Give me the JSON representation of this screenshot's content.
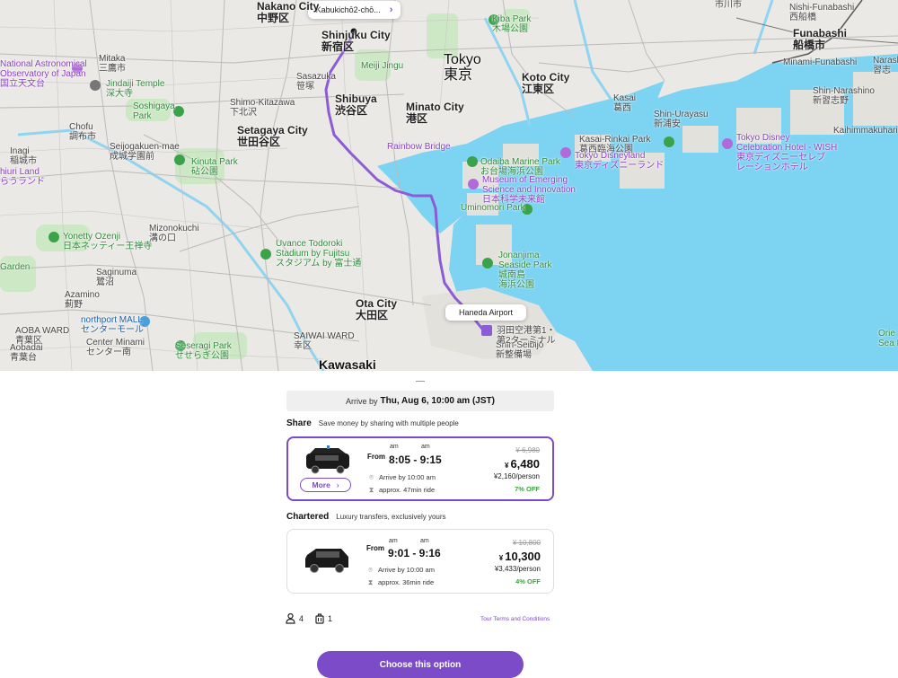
{
  "map": {
    "pickup_label": "Kabukichō2-chō...",
    "dropoff_label": "Haneda Airport",
    "places": [
      {
        "key": "nakano",
        "text": "Nakano City\n中野区"
      },
      {
        "key": "shinjuku",
        "text": "Shinjuku City\n新宿区"
      },
      {
        "key": "tokyo",
        "text": "Tokyo\n東京"
      },
      {
        "key": "koto",
        "text": "Koto City\n江東区"
      },
      {
        "key": "funabashi",
        "text": "Funabashi\n船橋市"
      },
      {
        "key": "shibuya",
        "text": "Shibuya\n渋谷区"
      },
      {
        "key": "minato",
        "text": "Minato City\n港区"
      },
      {
        "key": "setagaya",
        "text": "Setagaya City\n世田谷区"
      },
      {
        "key": "ota",
        "text": "Ota City\n大田区"
      },
      {
        "key": "kawasaki",
        "text": "Kawasaki"
      },
      {
        "key": "mitaka",
        "text": "Mitaka\n三鷹市"
      },
      {
        "key": "chofu",
        "text": "Chofu\n調布市"
      },
      {
        "key": "inagi",
        "text": "Inagi\n稲城市"
      },
      {
        "key": "azamino",
        "text": "Azamino\n薊野"
      },
      {
        "key": "aoba",
        "text": "AOBA WARD\n青葉区"
      },
      {
        "key": "aobadai",
        "text": "Aobadai\n青葉台"
      },
      {
        "key": "center",
        "text": "Center Minami\nセンター南"
      },
      {
        "key": "saginuma",
        "text": "Saginuma\n鷺沼"
      },
      {
        "key": "mizonokuchi",
        "text": "Mizonokuchi\n溝の口"
      },
      {
        "key": "seijo",
        "text": "Seijogakuen-mae\n成城学園前"
      },
      {
        "key": "shimokitazawa",
        "text": "Shimo-Kitazawa\n下北沢"
      },
      {
        "key": "sasazuka",
        "text": "Sasazuka\n笹塚"
      },
      {
        "key": "saiwai",
        "text": "SAIWAI WARD\n幸区"
      },
      {
        "key": "kasai",
        "text": "Kasai\n葛西"
      },
      {
        "key": "urayasu",
        "text": "Shin-Urayasu\n新浦安"
      },
      {
        "key": "narashino",
        "text": "Shin-Narashino\n新習志野"
      },
      {
        "key": "minamifuna",
        "text": "Minami-Funabashi"
      },
      {
        "key": "nishifuna",
        "text": "Nishi-Funabashi\n西船橋"
      },
      {
        "key": "kaihin",
        "text": "Kaihimmakuhari"
      },
      {
        "key": "shinseibijo",
        "text": "Shin-Seibijō\n新整備場"
      },
      {
        "key": "ichikawa",
        "text": "市川市"
      },
      {
        "key": "narash",
        "text": "Narash\n習志"
      }
    ],
    "pois": [
      {
        "key": "astro",
        "text": "National Astronomical\nObservatory of Japan\n国立天文台"
      },
      {
        "key": "jindaiji",
        "text": "Jindaiji Temple\n深大寺"
      },
      {
        "key": "soshigaya",
        "text": "Soshigaya\nPark"
      },
      {
        "key": "kinuta",
        "text": "Kinuta Park\n砧公園"
      },
      {
        "key": "yonetty",
        "text": "Yonetty Ozenji\n日本ネッティー王禅寺"
      },
      {
        "key": "uvance",
        "text": "Uvance Todoroki\nStadium by Fujitsu\nスタジアム by 富士通"
      },
      {
        "key": "seseragi",
        "text": "Seseragi Park\nせせらぎ公園"
      },
      {
        "key": "odaiba",
        "text": "Odaiba Marine Park\nお台場海浜公園"
      },
      {
        "key": "museum",
        "text": "Museum of Emerging\nScience and Innovation\n日本科学未来館"
      },
      {
        "key": "umi",
        "text": "Uminomori Park"
      },
      {
        "key": "jonanjima",
        "text": "Jonanjima\nSeaside Park\n城南島\n海浜公園"
      },
      {
        "key": "kasaipark",
        "text": "Kasai-Rinkai Park\n葛西臨海公園"
      },
      {
        "key": "disney",
        "text": "Tokyo Disneyland\n東京ディズニーランド"
      },
      {
        "key": "celebration",
        "text": "Tokyo Disney\nCelebration Hotel - WISH\n東京ディズニーセレブ\nレーションホテル"
      },
      {
        "key": "kiba",
        "text": "Kiba Park\n木場公園"
      },
      {
        "key": "rainbow",
        "text": "Rainbow Bridge"
      },
      {
        "key": "northport",
        "text": "northport MALL\nセンターモール"
      },
      {
        "key": "haneda_t2",
        "text": "羽田空港第1・\n第2ターミナル"
      },
      {
        "key": "akasaka",
        "text": "Meiji Jingu"
      },
      {
        "key": "land",
        "text": "hiuri Land\nらうランド"
      },
      {
        "key": "garden",
        "text": "Garden"
      },
      {
        "key": "orie",
        "text": "Orie\nSea P"
      }
    ]
  },
  "arrive": {
    "prefix": "Arrive by",
    "value": "Thu, Aug 6, 10:00 am (JST)"
  },
  "share": {
    "title": "Share",
    "subtitle": "Save money by sharing with multiple people",
    "from": "From",
    "am1": "am",
    "am2": "am",
    "times": "8:05 - 9:15",
    "arrive_by": "Arrive by 10:00 am",
    "duration": "approx. 47min ride",
    "old_price": "¥ 6,980",
    "currency": "¥",
    "price": "6,480",
    "per_person": "¥2,160/person",
    "discount": "7% OFF",
    "more_label": "More"
  },
  "chartered": {
    "title": "Chartered",
    "subtitle": "Luxury transfers, exclusively yours",
    "from": "From",
    "am1": "am",
    "am2": "am",
    "times": "9:01 - 9:16",
    "arrive_by": "Arrive by 10:00 am",
    "duration": "approx. 36min ride",
    "old_price": "¥ 10,800",
    "currency": "¥",
    "price": "10,300",
    "per_person": "¥3,433/person",
    "discount": "4% OFF"
  },
  "passengers": "4",
  "luggage": "1",
  "terms_label": "Tour Terms and Conditions",
  "cta_label": "Choose this option",
  "colors": {
    "accent": "#7b4bc8",
    "route": "#8c5bd6",
    "water": "#7cd3f2",
    "discount": "#3aa63a"
  }
}
